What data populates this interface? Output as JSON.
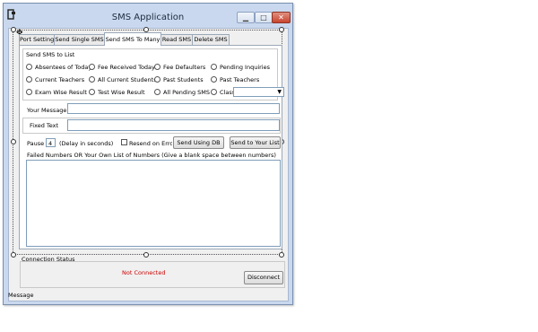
{
  "window": {
    "title": "SMS Application",
    "icon": "app-icon",
    "controls": {
      "minimize": "▁",
      "maximize": "□",
      "close": "✕"
    }
  },
  "tabs": [
    {
      "label": "Port Settings",
      "active": false
    },
    {
      "label": "Send Single SMS",
      "active": false
    },
    {
      "label": "Send SMS To Many",
      "active": true
    },
    {
      "label": "Read SMS",
      "active": false
    },
    {
      "label": "Delete SMS",
      "active": false
    }
  ],
  "send_sms_to_list": {
    "title": "Send SMS to List",
    "options": [
      "Absentees of Today",
      "Fee Received Today",
      "Fee Defaulters",
      "Pending Inquiries",
      "Current Teachers",
      "All Current Students",
      "Past Students",
      "Past Teachers",
      "Exam Wise Result",
      "Test Wise Result",
      "All Pending SMS",
      "Class:"
    ],
    "class_select_value": ""
  },
  "message": {
    "your_message_label": "Your Message",
    "your_message_value": "",
    "fixed_text_label": "Fixed Text",
    "fixed_text_value": ""
  },
  "controls": {
    "pause_label": "Pause",
    "pause_value": "4",
    "delay_label": "(Delay in seconds)",
    "resend_label": "Resend on Error",
    "send_db_button": "Send Using DB",
    "send_list_button": "Send to Your List"
  },
  "numbers": {
    "label": "Failed Numbers OR Your Own List of Numbers (Give a blank space between numbers)",
    "value": ""
  },
  "connection": {
    "label": "Connection Status",
    "status": "Not Connected",
    "status_color": "#cc0000",
    "disconnect_button": "Disconnect"
  },
  "status_bar": {
    "message": "Message"
  }
}
